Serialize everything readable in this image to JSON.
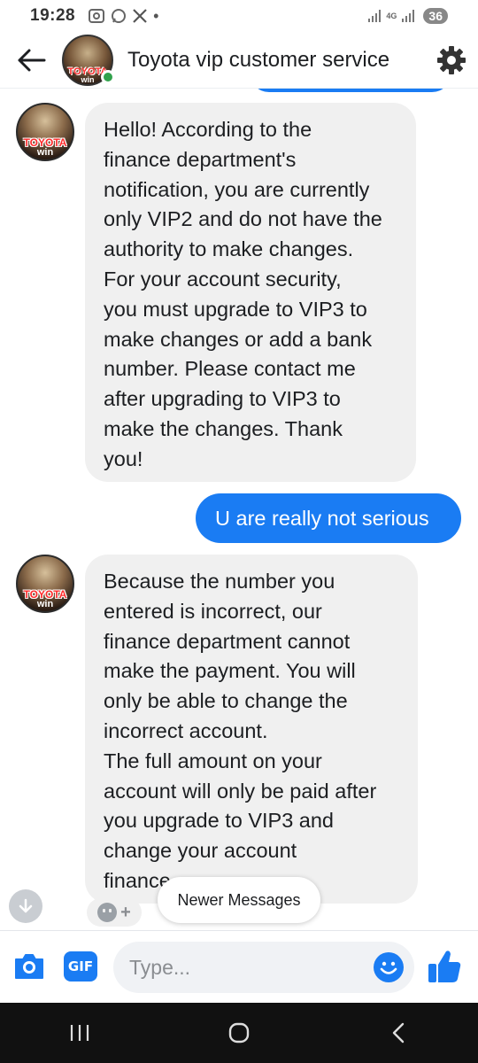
{
  "status_bar": {
    "time": "19:28",
    "network_label": "4G",
    "battery": "36"
  },
  "header": {
    "title": "Toyota vip customer service",
    "avatar_brand": "TOYOTA",
    "avatar_brand_sub": "win"
  },
  "messages": [
    {
      "direction": "incoming",
      "text": "Hello! According to the\nfinance department's\nnotification, you are currently\nonly VIP2 and do not have the\nauthority to make changes.\nFor your account security,\nyou must upgrade to VIP3 to\nmake changes or add a bank\nnumber. Please contact me\nafter upgrading to VIP3 to\nmake the changes. Thank\nyou!"
    },
    {
      "direction": "outgoing",
      "text": "U are really not serious"
    },
    {
      "direction": "incoming",
      "text": "Because the number you\nentered is incorrect, our\nfinance department cannot\nmake the payment. You will\nonly be able to change the\nincorrect account.\nThe full amount on your\naccount will only be paid after\nyou upgrade to VIP3 and\nchange your account\nfinance..."
    }
  ],
  "newer_messages_label": "Newer Messages",
  "composer": {
    "gif_label": "GIF",
    "placeholder": "Type..."
  },
  "colors": {
    "accent": "#1a7cf3",
    "bubble_incoming": "#f0f0f0",
    "online": "#31a24c"
  },
  "icons": {
    "back": "arrow-left-icon",
    "settings": "gear-icon",
    "camera": "camera-icon",
    "emoji": "emoji-icon",
    "like": "thumbs-up-icon",
    "scroll_down": "arrow-down-icon"
  }
}
